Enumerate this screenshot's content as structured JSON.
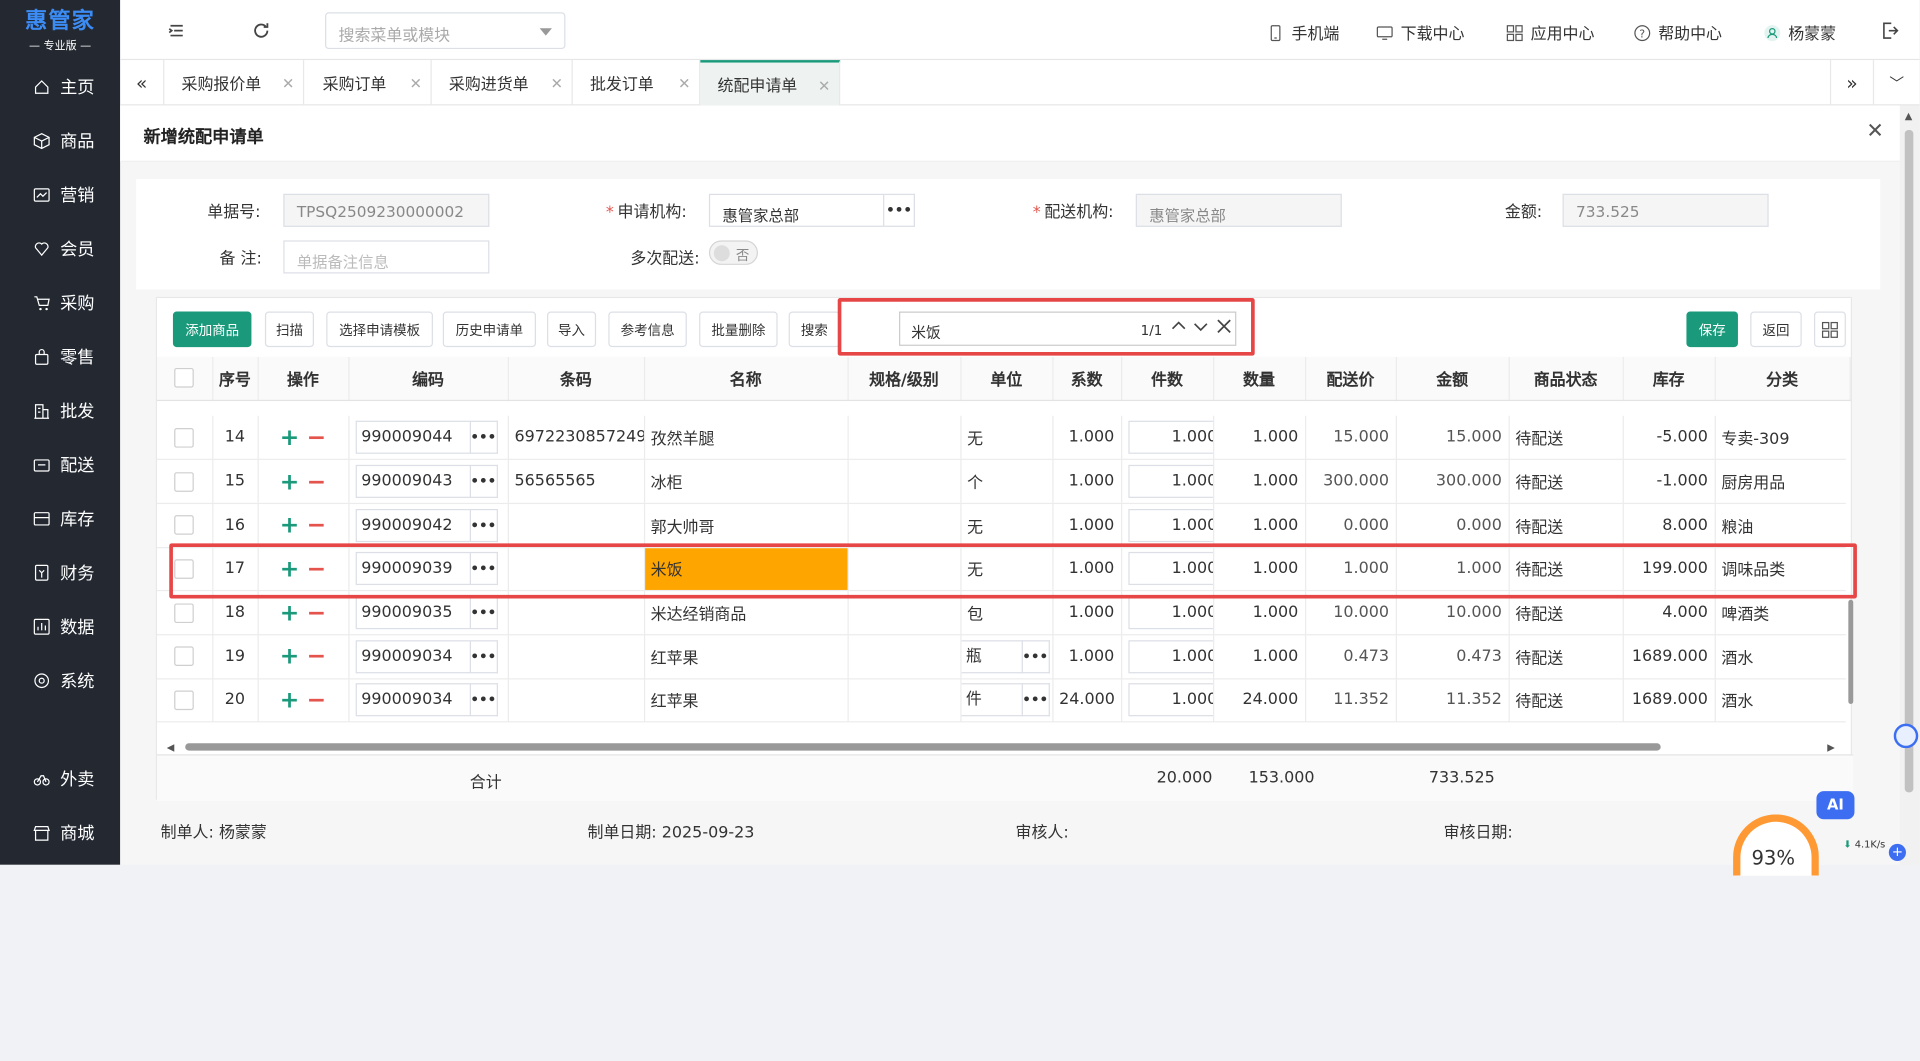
{
  "brand": {
    "name": "惠管家",
    "edition": "— 专业版 —"
  },
  "sidebar": {
    "items": [
      {
        "label": "主页",
        "icon": "home-icon"
      },
      {
        "label": "商品",
        "icon": "box-icon"
      },
      {
        "label": "营销",
        "icon": "chart-icon"
      },
      {
        "label": "会员",
        "icon": "heart-icon"
      },
      {
        "label": "采购",
        "icon": "cart-icon"
      },
      {
        "label": "零售",
        "icon": "bag-icon"
      },
      {
        "label": "批发",
        "icon": "building-icon"
      },
      {
        "label": "配送",
        "icon": "truck-icon"
      },
      {
        "label": "库存",
        "icon": "archive-icon"
      },
      {
        "label": "财务",
        "icon": "finance-icon"
      },
      {
        "label": "数据",
        "icon": "data-icon"
      },
      {
        "label": "系统",
        "icon": "gear-icon"
      },
      {
        "label": "外卖",
        "icon": "bike-icon"
      },
      {
        "label": "商城",
        "icon": "store-icon"
      }
    ]
  },
  "topbar": {
    "search_placeholder": "搜索菜单或模块",
    "links": [
      "手机端",
      "下载中心",
      "应用中心",
      "帮助中心"
    ],
    "user": "杨蒙蒙"
  },
  "tabs": [
    "采购报价单",
    "采购订单",
    "采购进货单",
    "批发订单",
    "统配申请单"
  ],
  "active_tab": "统配申请单",
  "panel": {
    "title": "新增统配申请单"
  },
  "form": {
    "order_no_label": "单据号:",
    "order_no": "TPSQ2509230000002",
    "apply_org_label": "申请机构:",
    "apply_org": "惠管家总部",
    "delivery_org_label": "配送机构:",
    "delivery_org": "惠管家总部",
    "amount_label": "金额:",
    "amount": "733.525",
    "remark_label": "备 注:",
    "remark_placeholder": "单据备注信息",
    "multi_label": "多次配送:",
    "multi_value": "否"
  },
  "toolbar": {
    "buttons": [
      "添加商品",
      "扫描",
      "选择申请模板",
      "历史申请单",
      "导入",
      "参考信息",
      "批量删除",
      "搜索"
    ],
    "search_term": "米饭",
    "match_count": "1/1",
    "save": "保存",
    "back": "返回"
  },
  "table": {
    "headers": [
      "序号",
      "操作",
      "编码",
      "条码",
      "名称",
      "规格/级别",
      "单位",
      "系数",
      "件数",
      "数量",
      "配送价",
      "金额",
      "商品状态",
      "库存",
      "分类"
    ],
    "rows": [
      {
        "no": "14",
        "code": "990009044",
        "barcode": "6972230857249",
        "name": "孜然羊腿",
        "spec": "",
        "unit": "无",
        "factor": "1.000",
        "pieces": "1.000",
        "qty": "1.000",
        "price": "15.000",
        "amount": "15.000",
        "status": "待配送",
        "stock": "-5.000",
        "category": "专卖-309"
      },
      {
        "no": "15",
        "code": "990009043",
        "barcode": "56565565",
        "name": "冰柜",
        "spec": "",
        "unit": "个",
        "factor": "1.000",
        "pieces": "1.000",
        "qty": "1.000",
        "price": "300.000",
        "amount": "300.000",
        "status": "待配送",
        "stock": "-1.000",
        "category": "厨房用品"
      },
      {
        "no": "16",
        "code": "990009042",
        "barcode": "",
        "name": "郭大帅哥",
        "spec": "",
        "unit": "无",
        "factor": "1.000",
        "pieces": "1.000",
        "qty": "1.000",
        "price": "0.000",
        "amount": "0.000",
        "status": "待配送",
        "stock": "8.000",
        "category": "粮油"
      },
      {
        "no": "17",
        "code": "990009039",
        "barcode": "",
        "name": "米饭",
        "spec": "",
        "unit": "无",
        "factor": "1.000",
        "pieces": "1.000",
        "qty": "1.000",
        "price": "1.000",
        "amount": "1.000",
        "status": "待配送",
        "stock": "199.000",
        "category": "调味品类"
      },
      {
        "no": "18",
        "code": "990009035",
        "barcode": "",
        "name": "米达经销商品",
        "spec": "",
        "unit": "包",
        "factor": "1.000",
        "pieces": "1.000",
        "qty": "1.000",
        "price": "10.000",
        "amount": "10.000",
        "status": "待配送",
        "stock": "4.000",
        "category": "啤酒类"
      },
      {
        "no": "19",
        "code": "990009034",
        "barcode": "",
        "name": "红苹果",
        "spec": "",
        "unit": "瓶",
        "factor": "1.000",
        "pieces": "1.000",
        "qty": "1.000",
        "price": "0.473",
        "amount": "0.473",
        "status": "待配送",
        "stock": "1689.000",
        "category": "酒水"
      },
      {
        "no": "20",
        "code": "990009034",
        "barcode": "",
        "name": "红苹果",
        "spec": "",
        "unit": "件",
        "factor": "24.000",
        "pieces": "1.000",
        "qty": "24.000",
        "price": "11.352",
        "amount": "11.352",
        "status": "待配送",
        "stock": "1689.000",
        "category": "酒水"
      }
    ],
    "totals": {
      "label": "合计",
      "pieces": "20.000",
      "qty": "153.000",
      "amount": "733.525"
    }
  },
  "footer": {
    "creator_label": "制单人:",
    "creator": "杨蒙蒙",
    "date_label": "制单日期:",
    "date": "2025-09-23",
    "auditor_label": "审核人:",
    "audit_date_label": "审核日期:"
  },
  "widgets": {
    "ai": "AI",
    "speed_percent": "93%",
    "net_speed": "4.1K/s"
  },
  "colors": {
    "accent": "#1a9a7b",
    "highlight": "#ffa500",
    "sidebar": "#232831",
    "annotation": "#e74646"
  }
}
